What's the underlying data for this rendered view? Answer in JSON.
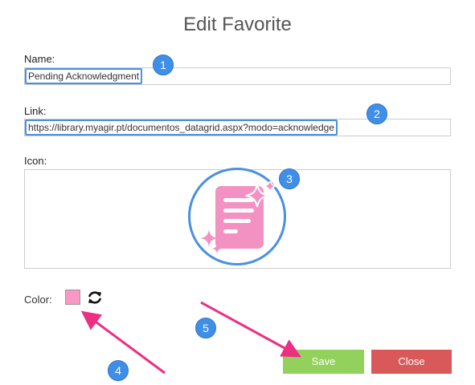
{
  "dialog": {
    "title": "Edit Favorite",
    "name_label": "Name:",
    "name_value": "Pending Acknowledgment",
    "link_label": "Link:",
    "link_value": "https://library.myagir.pt/documentos_datagrid.aspx?modo=acknowledge",
    "icon_label": "Icon:",
    "color_label": "Color:",
    "color_value": "#f898c7",
    "save_label": "Save",
    "close_label": "Close"
  },
  "annotations": {
    "badge_1": "1",
    "badge_2": "2",
    "badge_3": "3",
    "badge_4": "4",
    "badge_5": "5"
  },
  "icons": {
    "selected_icon": "document-sparkle-icon",
    "refresh": "refresh-icon"
  },
  "colors": {
    "accent": "#4a90e2",
    "save": "#91d15c",
    "close": "#d9595a",
    "arrow": "#ec2f82"
  }
}
